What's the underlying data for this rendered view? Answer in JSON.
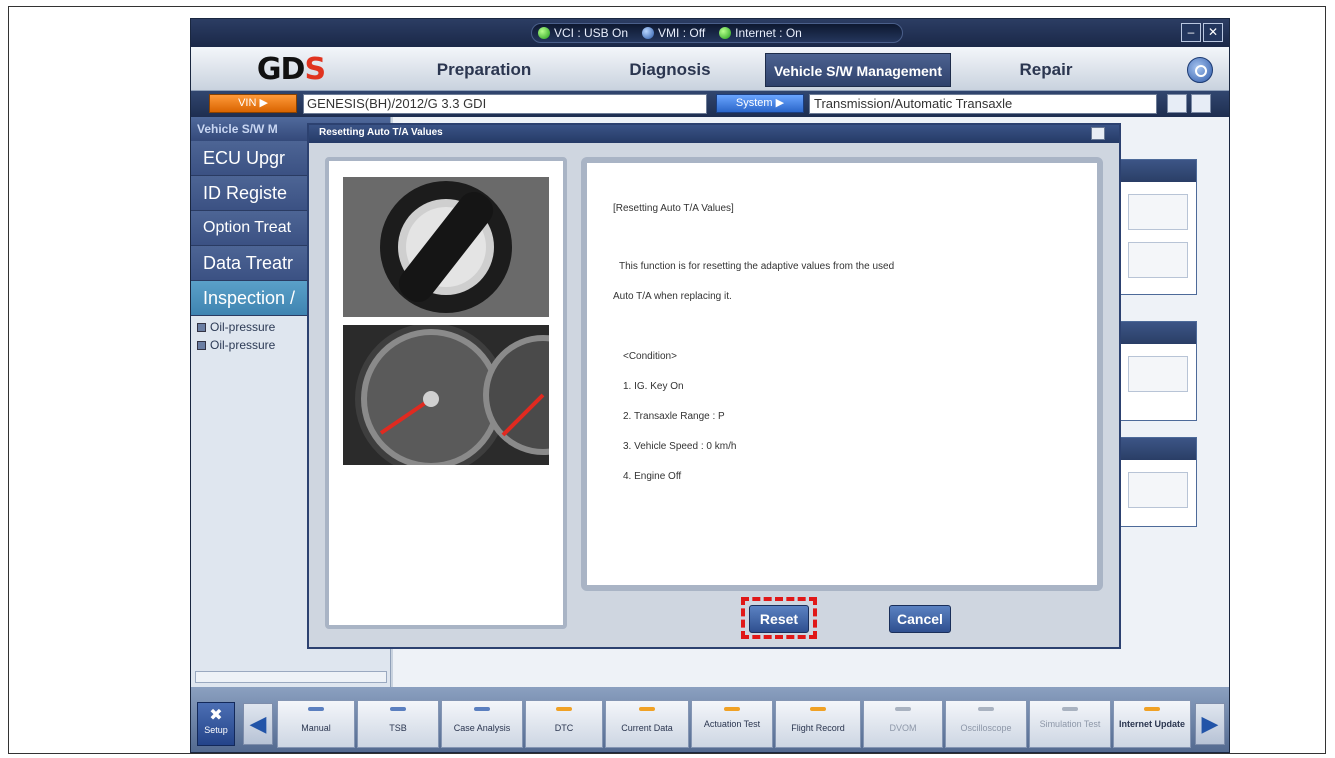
{
  "status": {
    "vci": "VCI : USB On",
    "vmi": "VMI : Off",
    "internet": "Internet : On"
  },
  "window": {
    "minimize": "–",
    "close": "✕"
  },
  "menu": {
    "logo_left": "GD",
    "logo_right": "S",
    "items": [
      "Preparation",
      "Diagnosis",
      "Vehicle S/W Management",
      "Repair"
    ]
  },
  "vehicle": {
    "vin_label": "VIN ▶",
    "vehicle_value": "GENESIS(BH)/2012/G 3.3 GDI",
    "system_label": "System ▶",
    "system_value": "Transmission/Automatic Transaxle"
  },
  "sidebar": {
    "header": "Vehicle S/W M",
    "items": [
      "ECU Upgr",
      "ID Registe",
      "Option Treat",
      "Data Treatr",
      "Inspection /"
    ],
    "subitems": [
      "Oil-pressure",
      "Oil-pressure"
    ]
  },
  "dialog": {
    "title": "Resetting Auto T/A Values",
    "heading": "[Resetting Auto T/A Values]",
    "desc1": "This function is for resetting the adaptive values from the used",
    "desc2": "Auto T/A when replacing it.",
    "condition": "<Condition>",
    "conditions": [
      "1. IG. Key On",
      "2. Transaxle Range : P",
      "3. Vehicle Speed : 0 km/h",
      "4. Engine Off"
    ],
    "reset": "Reset",
    "cancel": "Cancel"
  },
  "toolbar": {
    "setup": "Setup",
    "buttons": [
      "Manual",
      "TSB",
      "Case Analysis",
      "DTC",
      "Current Data",
      "Actuation Test",
      "Flight Record",
      "DVOM",
      "Oscilloscope",
      "Simulation Test",
      "Internet Update"
    ]
  },
  "colors": {
    "highlight": "#e01818",
    "active_menu": "#2f426c",
    "status_green": "#1f9d1a"
  }
}
